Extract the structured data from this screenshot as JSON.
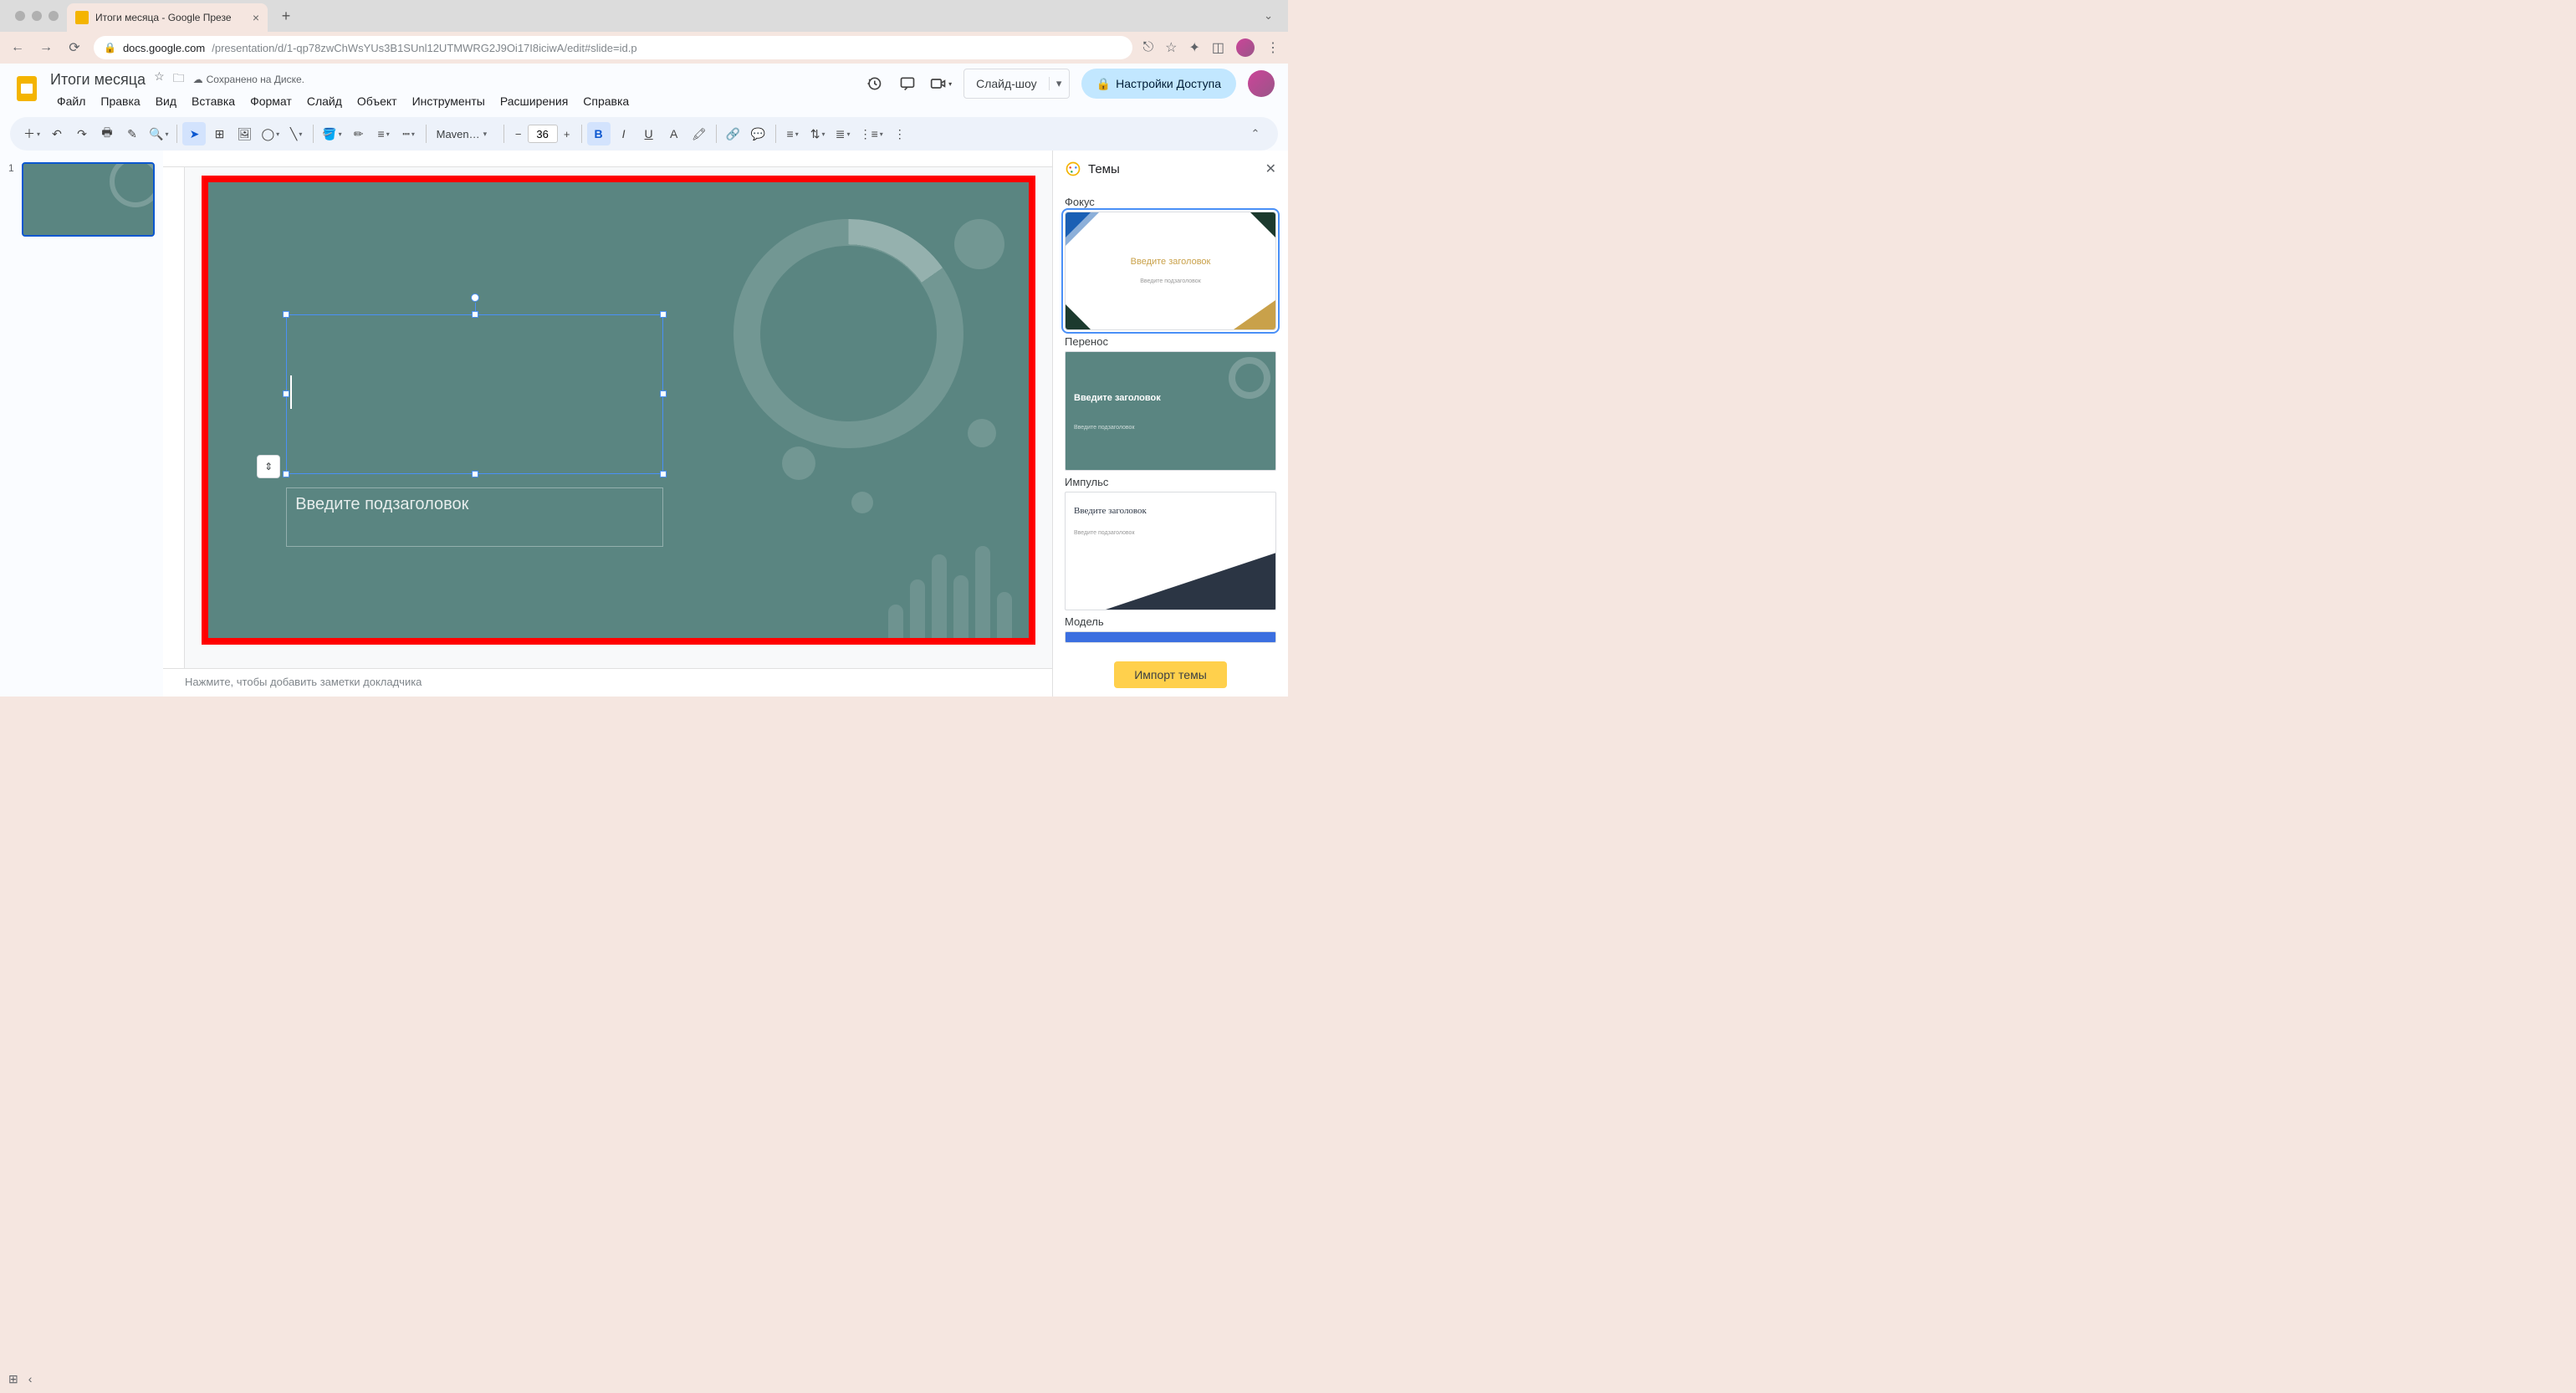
{
  "browser": {
    "tab_title": "Итоги месяца - Google Презе",
    "url_host": "docs.google.com",
    "url_path": "/presentation/d/1-qp78zwChWsYUs3B1SUnl12UTMWRG2J9Oi17I8iciwA/edit#slide=id.p"
  },
  "header": {
    "doc_title": "Итоги месяца",
    "save_status": "Сохранено на Диске.",
    "menus": [
      "Файл",
      "Правка",
      "Вид",
      "Вставка",
      "Формат",
      "Слайд",
      "Объект",
      "Инструменты",
      "Расширения",
      "Справка"
    ],
    "slideshow_label": "Слайд-шоу",
    "share_label": "Настройки Доступа"
  },
  "toolbar": {
    "font_name": "Maven…",
    "font_size": "36"
  },
  "filmstrip": {
    "slides": [
      {
        "number": "1"
      }
    ]
  },
  "canvas": {
    "subtitle_placeholder": "Введите подзаголовок"
  },
  "notes": {
    "placeholder": "Нажмите, чтобы добавить заметки докладчика"
  },
  "themes": {
    "panel_title": "Темы",
    "items": [
      {
        "name": "Фокус",
        "title": "Введите заголовок",
        "sub": "Введите подзаголовок"
      },
      {
        "name": "Перенос",
        "title": "Введите заголовок",
        "sub": "Введите подзаголовок"
      },
      {
        "name": "Импульс",
        "title": "Введите заголовок",
        "sub": "Введите подзаголовок"
      },
      {
        "name": "Модель",
        "title": "",
        "sub": ""
      }
    ],
    "import_label": "Импорт темы"
  }
}
